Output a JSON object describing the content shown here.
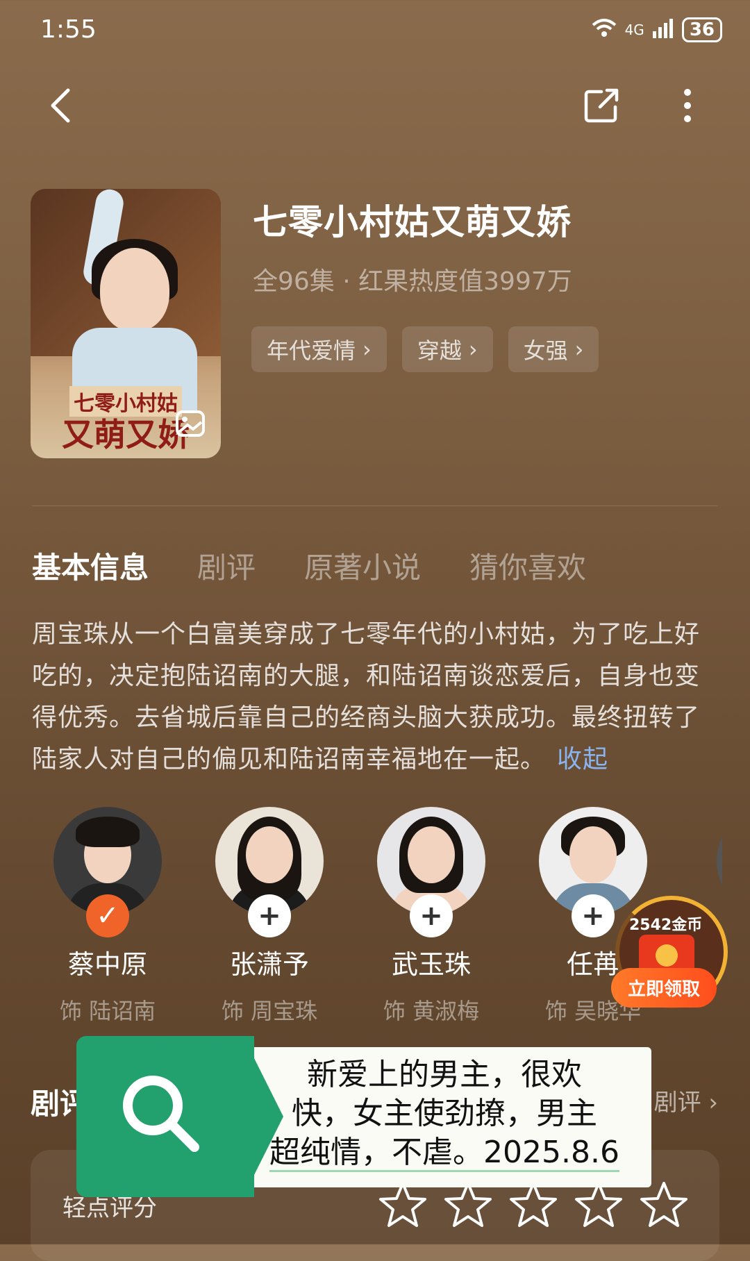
{
  "status_bar": {
    "time": "1:55",
    "network": "4G",
    "wifi_label": "6",
    "battery": "36"
  },
  "drama": {
    "title": "七零小村姑又萌又娇",
    "meta": "全96集 · 红果热度值3997万",
    "poster_title_line1": "七零小村姑",
    "poster_title_line2": "又萌又娇",
    "tags": [
      "年代爱情",
      "穿越",
      "女强"
    ]
  },
  "tabs": [
    "基本信息",
    "剧评",
    "原著小说",
    "猜你喜欢"
  ],
  "synopsis": {
    "text": "周宝珠从一个白富美穿成了七零年代的小村姑，为了吃上好吃的，决定抱陆诏南的大腿，和陆诏南谈恋爱后，自身也变得优秀。去省城后靠自己的经商头脑大获成功。最终扭转了陆家人对自己的偏见和陆诏南幸福地在一起。",
    "collapse_label": "收起"
  },
  "cast": [
    {
      "name": "蔡中原",
      "role": "饰 陆诏南",
      "followed": true,
      "bg": "#3a3a3a",
      "torso": "#222222"
    },
    {
      "name": "张潇予",
      "role": "饰 周宝珠",
      "followed": false,
      "bg": "#e9e3d8",
      "torso": "#1c1c1c"
    },
    {
      "name": "武玉珠",
      "role": "饰 黄淑梅",
      "followed": false,
      "bg": "#e6e6e8",
      "torso": "#2a2a2a"
    },
    {
      "name": "任苒",
      "role": "饰 吴晓华",
      "followed": false,
      "bg": "#eeeeee",
      "torso": "#6d8ba3"
    }
  ],
  "coin_widget": {
    "coins": "2542金币",
    "claim_label": "立即领取"
  },
  "review_section": {
    "heading": "剧评",
    "link": "剧评",
    "rating_label": "轻点评分",
    "stars_count": 5
  },
  "overlay_sticker": {
    "line1": "新爱上的男主，很欢",
    "line2": "快，女主使劲撩，男主",
    "line3": "超纯情，不虐。2025.8.6"
  },
  "colors": {
    "accent": "#f0642a",
    "link": "#8ab4f0",
    "sticker_green": "#22a06e"
  }
}
